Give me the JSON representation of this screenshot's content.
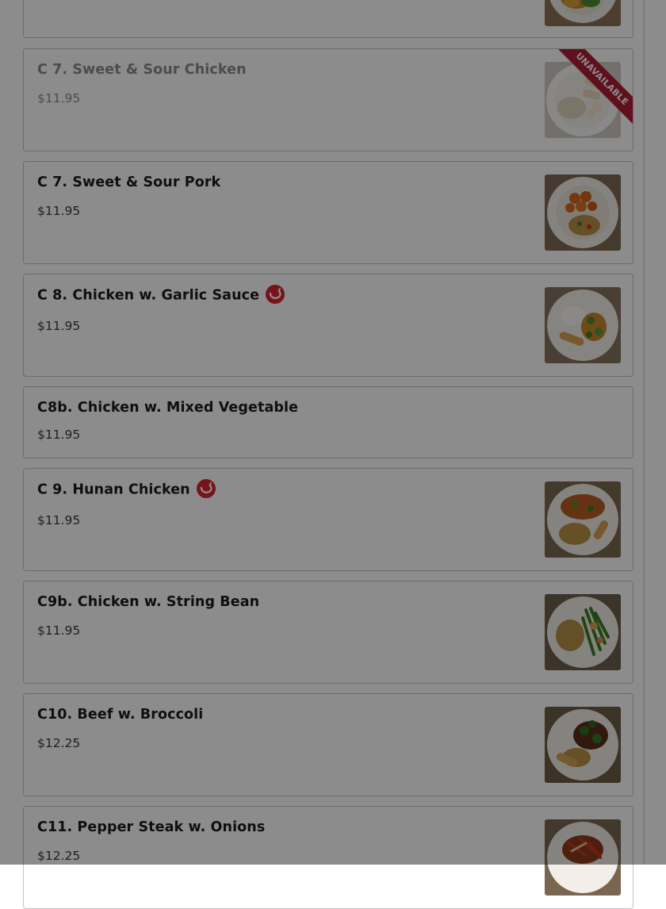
{
  "menu": {
    "items": [
      {
        "name": "",
        "price": ""
      },
      {
        "name": "C 7. Sweet & Sour Chicken",
        "price": "$11.95",
        "badge": "UNAVAILABLE"
      },
      {
        "name": "C 7. Sweet & Sour Pork",
        "price": "$11.95"
      },
      {
        "name": "C 8. Chicken w. Garlic Sauce",
        "price": "$11.95",
        "spicy": true
      },
      {
        "name": "C8b. Chicken w. Mixed Vegetable",
        "price": "$11.95"
      },
      {
        "name": "C 9. Hunan Chicken",
        "price": "$11.95",
        "spicy": true
      },
      {
        "name": "C9b. Chicken w. String Bean",
        "price": "$11.95"
      },
      {
        "name": "C10. Beef w. Broccoli",
        "price": "$12.25"
      },
      {
        "name": "C11. Pepper Steak w. Onions",
        "price": "$12.25"
      }
    ]
  },
  "colors": {
    "overlay": "rgba(0,0,0,0.45)",
    "unavailable_ribbon": "#b01d35",
    "spicy_badge": "#d9232e"
  },
  "icons": {
    "spicy": "chili-pepper-icon"
  }
}
